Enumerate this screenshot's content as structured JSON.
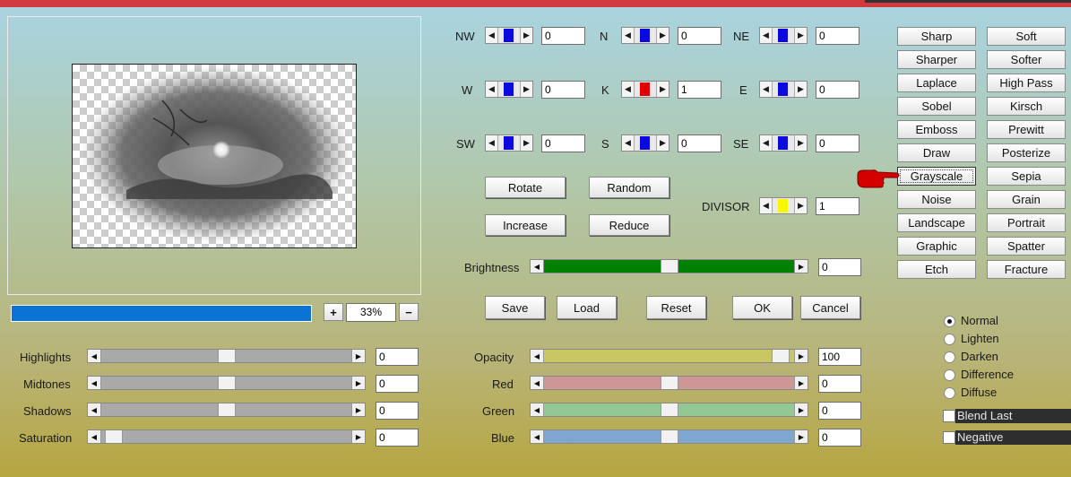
{
  "preview": {
    "zoom_value": "33%",
    "zoom_in": "+",
    "zoom_out": "−"
  },
  "matrix": {
    "nw": {
      "label": "NW",
      "value": "0"
    },
    "n": {
      "label": "N",
      "value": "0"
    },
    "ne": {
      "label": "NE",
      "value": "0"
    },
    "w": {
      "label": "W",
      "value": "0"
    },
    "k": {
      "label": "K",
      "value": "1"
    },
    "e": {
      "label": "E",
      "value": "0"
    },
    "sw": {
      "label": "SW",
      "value": "0"
    },
    "s": {
      "label": "S",
      "value": "0"
    },
    "se": {
      "label": "SE",
      "value": "0"
    },
    "divisor": {
      "label": "DIVISOR",
      "value": "1"
    }
  },
  "actions": {
    "rotate": "Rotate",
    "random": "Random",
    "increase": "Increase",
    "reduce": "Reduce"
  },
  "brightness": {
    "label": "Brightness",
    "value": "0"
  },
  "dialog": {
    "save": "Save",
    "load": "Load",
    "reset": "Reset",
    "ok": "OK",
    "cancel": "Cancel"
  },
  "presets": [
    [
      "Sharp",
      "Soft"
    ],
    [
      "Sharper",
      "Softer"
    ],
    [
      "Laplace",
      "High Pass"
    ],
    [
      "Sobel",
      "Kirsch"
    ],
    [
      "Emboss",
      "Prewitt"
    ],
    [
      "Draw",
      "Posterize"
    ],
    [
      "Grayscale",
      "Sepia"
    ],
    [
      "Noise",
      "Grain"
    ],
    [
      "Landscape",
      "Portrait"
    ],
    [
      "Graphic",
      "Spatter"
    ],
    [
      "Etch",
      "Fracture"
    ]
  ],
  "tones": {
    "highlights": {
      "label": "Highlights",
      "value": "0"
    },
    "midtones": {
      "label": "Midtones",
      "value": "0"
    },
    "shadows": {
      "label": "Shadows",
      "value": "0"
    },
    "saturation": {
      "label": "Saturation",
      "value": "0"
    }
  },
  "color": {
    "opacity": {
      "label": "Opacity",
      "value": "100"
    },
    "red": {
      "label": "Red",
      "value": "0"
    },
    "green": {
      "label": "Green",
      "value": "0"
    },
    "blue": {
      "label": "Blue",
      "value": "0"
    }
  },
  "blend_modes": [
    "Normal",
    "Lighten",
    "Darken",
    "Difference",
    "Diffuse"
  ],
  "options": {
    "blend_last": "Blend Last",
    "negative": "Negative"
  },
  "colors": {
    "k_thumb": "#e00000",
    "divisor_thumb": "#f7f700",
    "tap_thumb": "#0a0ae0",
    "brightness_track": "#008000",
    "opacity_track": "#c9c664",
    "red_track": "#cd9797",
    "green_track": "#93c793",
    "blue_track": "#7ea6cf"
  }
}
